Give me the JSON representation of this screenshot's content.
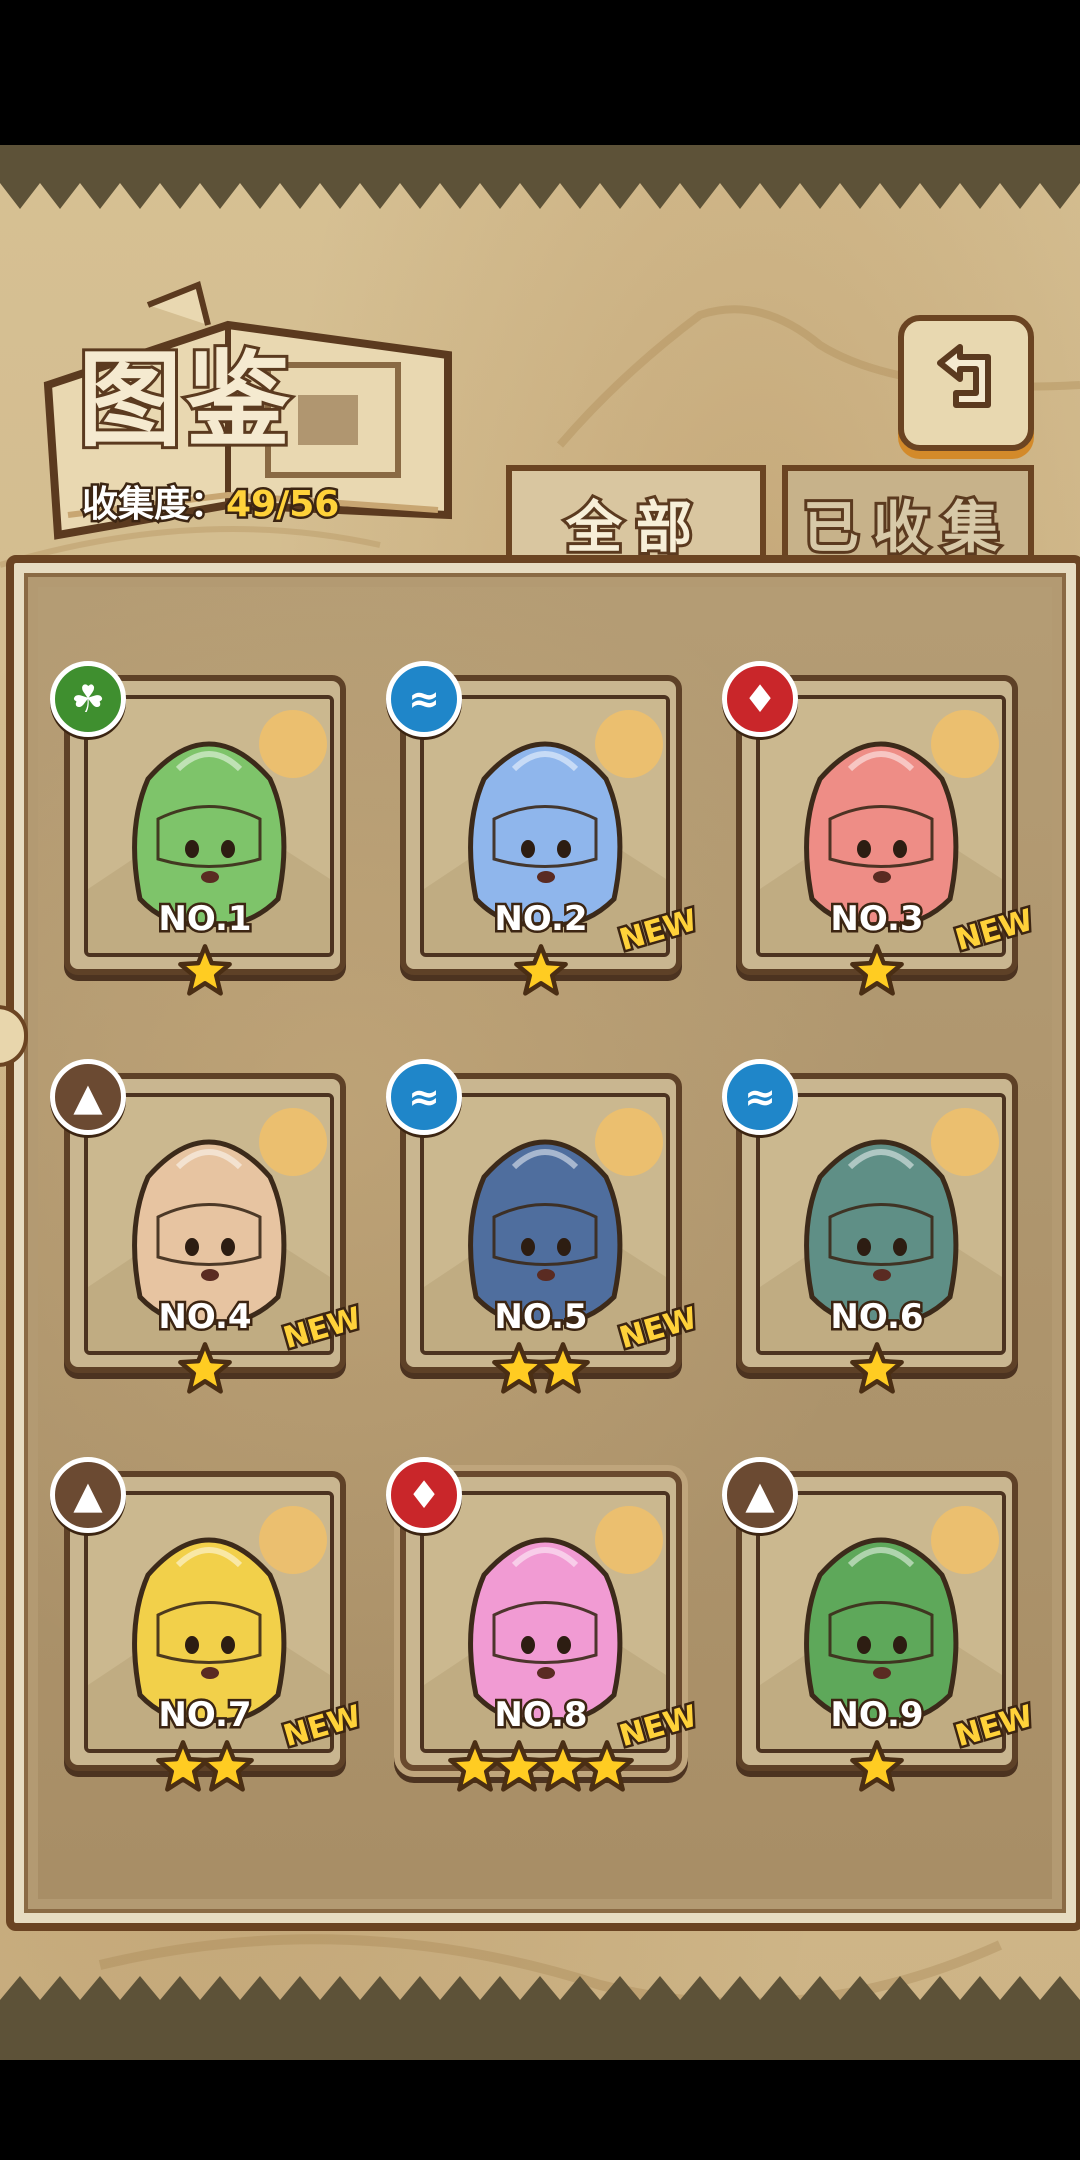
{
  "title": "图鉴",
  "collection": {
    "label": "收集度：",
    "value": "49/56"
  },
  "tabs": [
    {
      "label": "全部",
      "active": true
    },
    {
      "label": "已收集",
      "active": false
    }
  ],
  "colors": {
    "nature": "#3f8f2f",
    "water": "#1f86c9",
    "fire": "#c9262a",
    "earth": "#6b4a32",
    "star": "#ffcc22"
  },
  "cards": [
    {
      "no": "NO.1",
      "element": "nature-icon",
      "stars": 1,
      "new": "",
      "creature": "green-slime-girl",
      "tint": "#7ec46a"
    },
    {
      "no": "NO.2",
      "element": "water-icon",
      "stars": 1,
      "new": "NEW",
      "creature": "blue-slime-girl",
      "tint": "#8fb6ec"
    },
    {
      "no": "NO.3",
      "element": "fire-icon",
      "stars": 1,
      "new": "NEW",
      "creature": "red-slime-girl",
      "tint": "#ee8d86"
    },
    {
      "no": "NO.4",
      "element": "earth-icon",
      "stars": 1,
      "new": "NEW",
      "creature": "tan-slime-girl",
      "tint": "#e7c4a1"
    },
    {
      "no": "NO.5",
      "element": "water-icon",
      "stars": 2,
      "new": "NEW",
      "creature": "dark-blue-ghost-girl",
      "tint": "#4f6e9e"
    },
    {
      "no": "NO.6",
      "element": "water-icon",
      "stars": 1,
      "new": "",
      "creature": "teal-ghost-girl",
      "tint": "#5f8f86"
    },
    {
      "no": "NO.7",
      "element": "earth-icon",
      "stars": 2,
      "new": "NEW",
      "creature": "gold-slime-girl",
      "tint": "#f2d04a"
    },
    {
      "no": "NO.8",
      "element": "fire-icon",
      "stars": 4,
      "new": "NEW",
      "creature": "pink-slime-princess",
      "tint": "#f19bd3"
    },
    {
      "no": "NO.9",
      "element": "earth-icon",
      "stars": 1,
      "new": "NEW",
      "creature": "green-leaf-girl",
      "tint": "#5ea85a"
    }
  ]
}
